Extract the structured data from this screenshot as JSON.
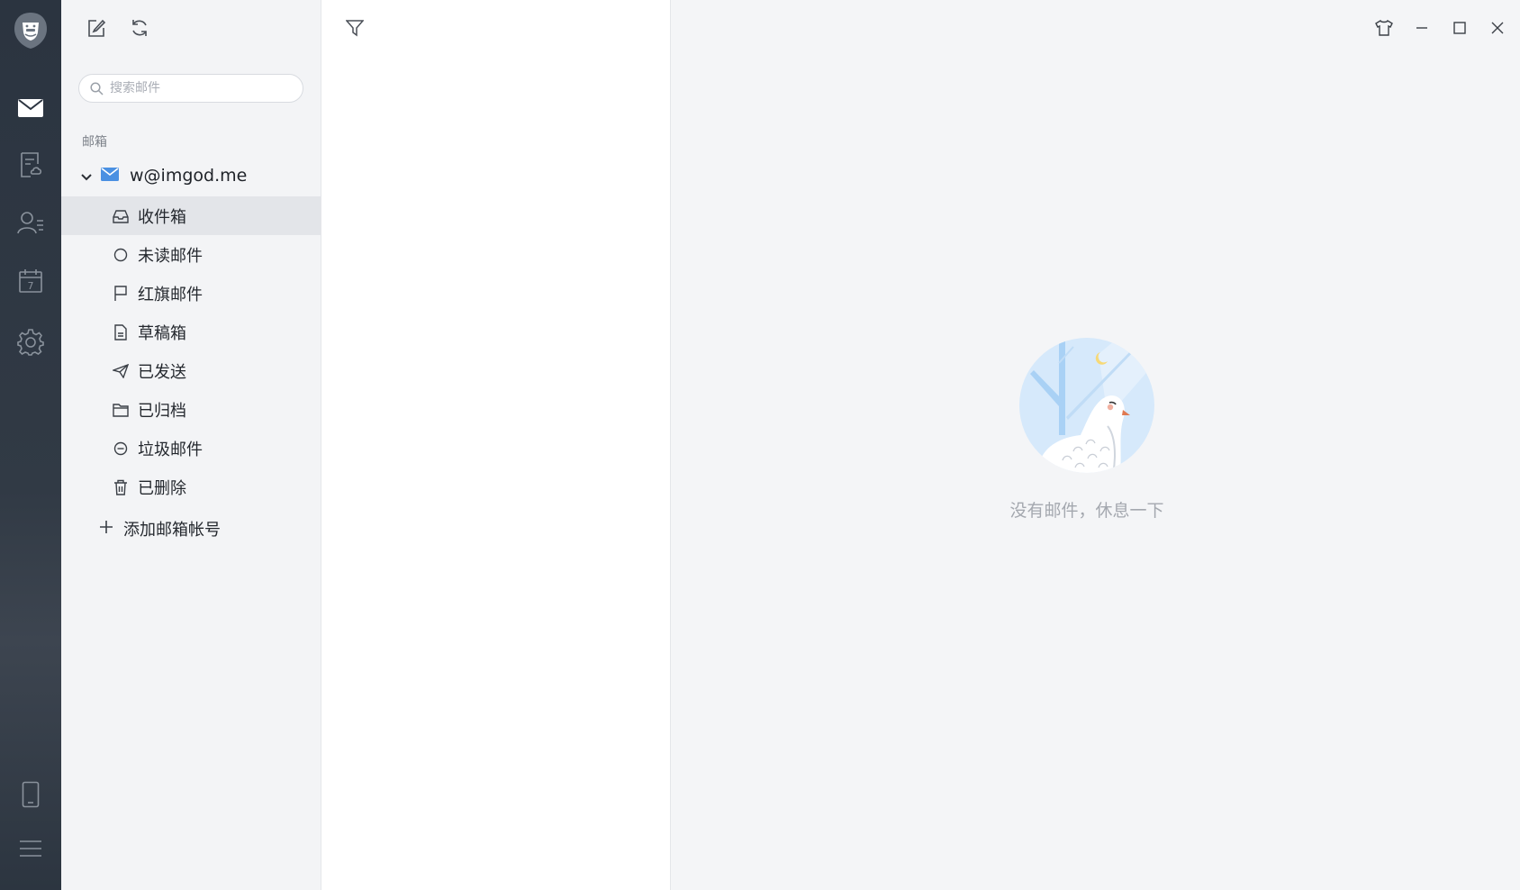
{
  "search": {
    "placeholder": "搜索邮件"
  },
  "mailbox": {
    "section_label": "邮箱",
    "account": "w@imgod.me",
    "folders": [
      {
        "label": "收件箱",
        "icon": "inbox-icon",
        "active": true
      },
      {
        "label": "未读邮件",
        "icon": "unread-circle-icon",
        "active": false
      },
      {
        "label": "红旗邮件",
        "icon": "flag-icon",
        "active": false
      },
      {
        "label": "草稿箱",
        "icon": "draft-icon",
        "active": false
      },
      {
        "label": "已发送",
        "icon": "send-icon",
        "active": false
      },
      {
        "label": "已归档",
        "icon": "archive-folder-icon",
        "active": false
      },
      {
        "label": "垃圾邮件",
        "icon": "spam-icon",
        "active": false
      },
      {
        "label": "已删除",
        "icon": "trash-icon",
        "active": false
      }
    ],
    "add_account": "添加邮箱帐号"
  },
  "reading_pane": {
    "empty_message": "没有邮件，休息一下"
  },
  "rail": {
    "items": [
      "mail-icon",
      "notes-icon",
      "contacts-icon",
      "calendar-icon",
      "settings-icon"
    ],
    "calendar_day": "7",
    "bottom": [
      "mobile-icon",
      "menu-icon"
    ]
  },
  "colors": {
    "rail_bg": "#2b3440",
    "folder_bg": "#f3f4f6",
    "active_row": "#e3e5e9",
    "accent_blue": "#4a90e2",
    "empty_text": "#a4a8af"
  }
}
